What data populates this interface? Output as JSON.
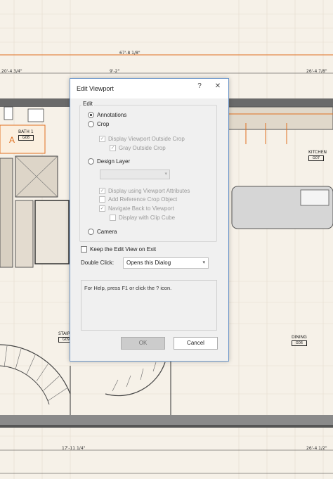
{
  "drawing": {
    "dimensions": [
      "67'-8 1/8\"",
      "20'-4 3/4\"",
      "9'-2\"",
      "26'-4 7/8\"",
      "17'-11 1/4\"",
      "26'-4 1/2\""
    ],
    "rooms": [
      {
        "name": "BATH 1",
        "code": "G08"
      },
      {
        "name": "KITCHEN",
        "code": "G07"
      },
      {
        "name": "STAIR",
        "code": "G09"
      },
      {
        "name": "DINING",
        "code": "G06"
      }
    ],
    "marker": "A",
    "colors": {
      "accent": "#e07020",
      "paper": "#f6f1e8",
      "wall": "#555555"
    }
  },
  "dialog": {
    "title": "Edit Viewport",
    "help_icon": "?",
    "close_icon": "✕",
    "edit_group_label": "Edit",
    "options": {
      "annotations": "Annotations",
      "crop": "Crop",
      "display_outside_crop": "Display Viewport Outside Crop",
      "gray_outside_crop": "Gray Outside Crop",
      "design_layer": "Design Layer",
      "display_viewport_attributes": "Display using Viewport Attributes",
      "add_reference_crop": "Add Reference Crop Object",
      "navigate_back": "Navigate Back to Viewport",
      "display_clip_cube": "Display with Clip Cube",
      "camera": "Camera"
    },
    "selected_option": "Annotations",
    "keep_edit_view": "Keep the Edit View on Exit",
    "double_click_label": "Double Click:",
    "double_click_value": "Opens this Dialog",
    "help_text": "For Help, press F1 or click the ? icon.",
    "ok_label": "OK",
    "cancel_label": "Cancel"
  }
}
